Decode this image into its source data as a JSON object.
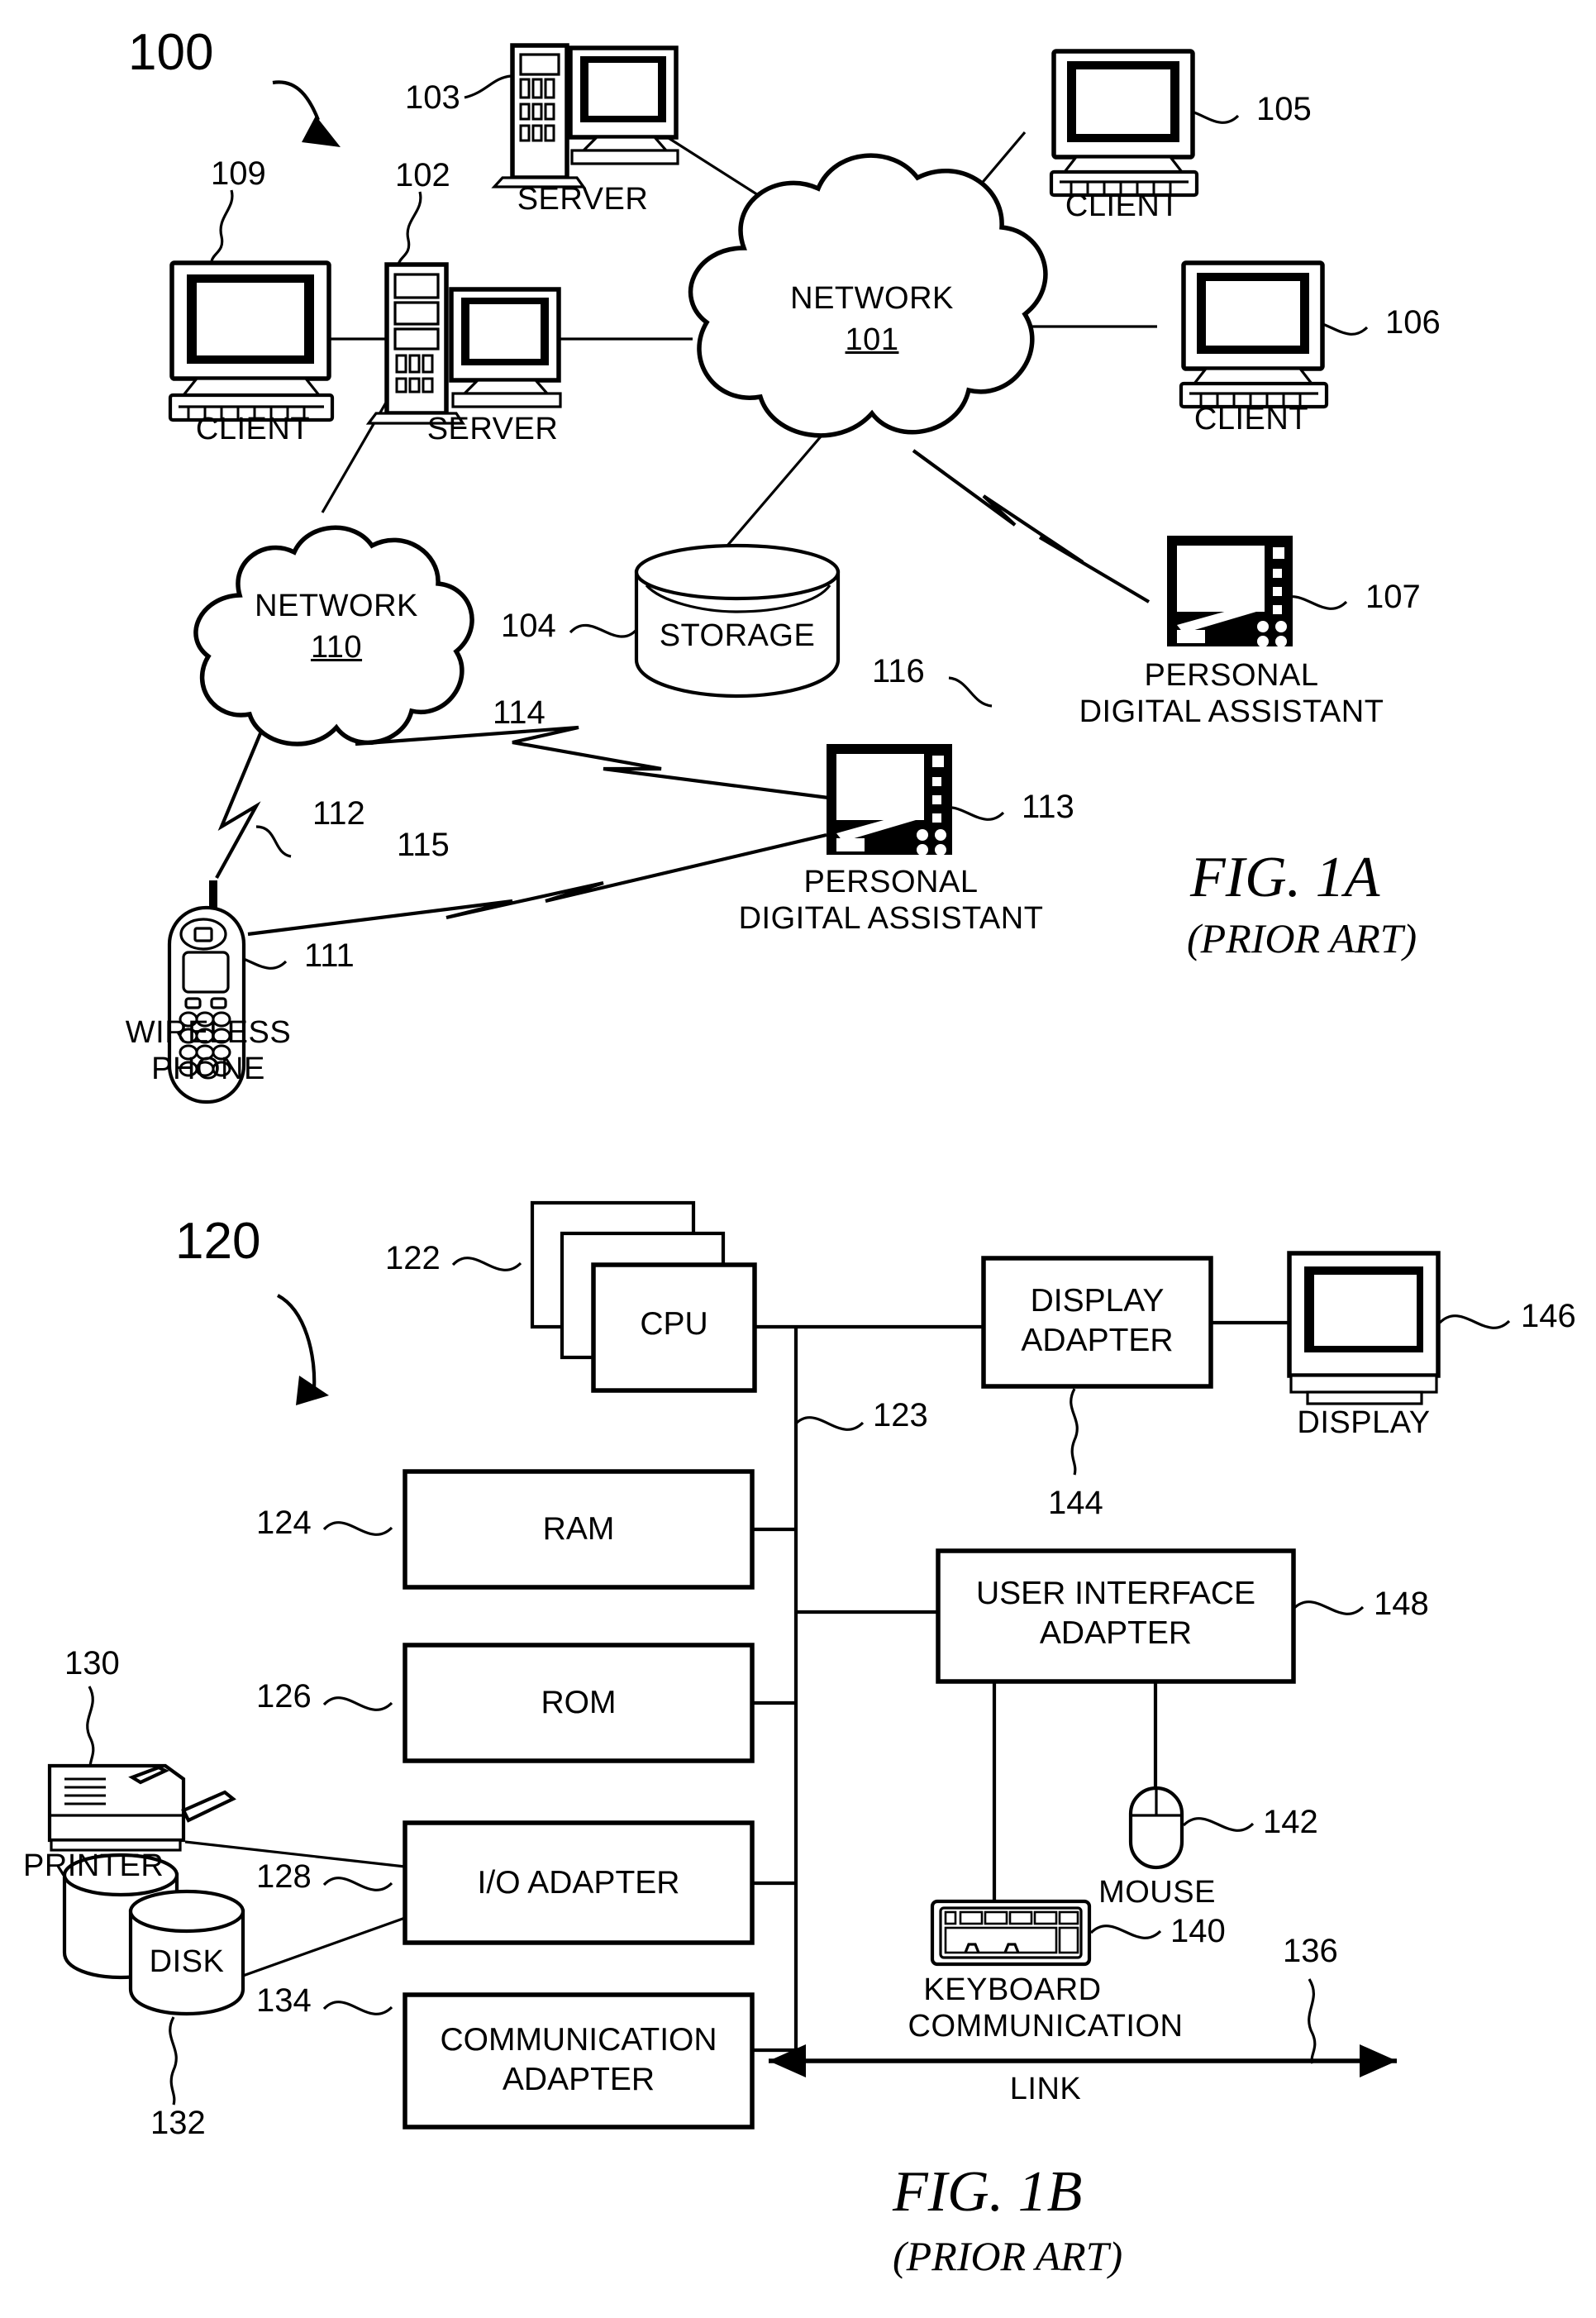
{
  "figures": [
    {
      "id": "fig-1a",
      "caption": "FIG. 1A",
      "subcaption": "(PRIOR ART)",
      "system_ref": "100",
      "nodes": [
        {
          "ref": "109",
          "label": "CLIENT",
          "type": "desktop-computer"
        },
        {
          "ref": "102",
          "label": "SERVER",
          "type": "server-tower"
        },
        {
          "ref": "103",
          "label": "SERVER",
          "type": "server-tower"
        },
        {
          "ref": "105",
          "label": "CLIENT",
          "type": "desktop-computer"
        },
        {
          "ref": "106",
          "label": "CLIENT",
          "type": "desktop-computer"
        },
        {
          "ref": "101",
          "label": "NETWORK",
          "type": "cloud"
        },
        {
          "ref": "110",
          "label": "NETWORK",
          "type": "cloud"
        },
        {
          "ref": "104",
          "label": "STORAGE",
          "type": "storage-cylinder"
        },
        {
          "ref": "107",
          "label": "PERSONAL DIGITAL ASSISTANT",
          "type": "pda"
        },
        {
          "ref": "113",
          "label": "PERSONAL DIGITAL ASSISTANT",
          "type": "pda"
        },
        {
          "ref": "111",
          "label": "WIRELESS PHONE",
          "type": "wireless-phone"
        }
      ],
      "wireless_links": [
        {
          "ref": "112"
        },
        {
          "ref": "114"
        },
        {
          "ref": "115"
        },
        {
          "ref": "116"
        }
      ]
    },
    {
      "id": "fig-1b",
      "caption": "FIG. 1B",
      "subcaption": "(PRIOR ART)",
      "system_ref": "120",
      "blocks": [
        {
          "ref": "122",
          "label": "CPU"
        },
        {
          "ref": "124",
          "label": "RAM"
        },
        {
          "ref": "126",
          "label": "ROM"
        },
        {
          "ref": "128",
          "label": "I/O ADAPTER"
        },
        {
          "ref": "134",
          "label": "COMMUNICATION ADAPTER"
        },
        {
          "ref": "144",
          "label": "DISPLAY ADAPTER"
        },
        {
          "ref": "148",
          "label": "USER INTERFACE ADAPTER"
        }
      ],
      "peripherals": [
        {
          "ref": "130",
          "label": "PRINTER"
        },
        {
          "ref": "132",
          "label": "DISK"
        },
        {
          "ref": "146",
          "label": "DISPLAY"
        },
        {
          "ref": "142",
          "label": "MOUSE"
        },
        {
          "ref": "140",
          "label": "KEYBOARD"
        }
      ],
      "bus": {
        "ref": "123"
      },
      "link": {
        "ref": "136",
        "label_line1": "COMMUNICATION",
        "label_line2": "LINK"
      }
    }
  ],
  "labels": {
    "client": "CLIENT",
    "server": "SERVER",
    "network": "NETWORK",
    "storage": "STORAGE",
    "pda_line1": "PERSONAL",
    "pda_line2": "DIGITAL ASSISTANT",
    "wireless_line1": "WIRELESS",
    "wireless_line2": "PHONE",
    "cpu": "CPU",
    "ram": "RAM",
    "rom": "ROM",
    "io_adapter": "I/O ADAPTER",
    "comm_adapter_l1": "COMMUNICATION",
    "comm_adapter_l2": "ADAPTER",
    "display_adapter_l1": "DISPLAY",
    "display_adapter_l2": "ADAPTER",
    "ui_adapter_l1": "USER INTERFACE",
    "ui_adapter_l2": "ADAPTER",
    "display": "DISPLAY",
    "mouse": "MOUSE",
    "keyboard": "KEYBOARD",
    "printer": "PRINTER",
    "disk": "DISK",
    "comm_link_l1": "COMMUNICATION",
    "comm_link_l2": "LINK"
  },
  "refs": {
    "r100": "100",
    "r101": "101",
    "r102": "102",
    "r103": "103",
    "r104": "104",
    "r105": "105",
    "r106": "106",
    "r107": "107",
    "r109": "109",
    "r110": "110",
    "r111": "111",
    "r112": "112",
    "r113": "113",
    "r114": "114",
    "r115": "115",
    "r116": "116",
    "r120": "120",
    "r122": "122",
    "r123": "123",
    "r124": "124",
    "r126": "126",
    "r128": "128",
    "r130": "130",
    "r132": "132",
    "r134": "134",
    "r136": "136",
    "r140": "140",
    "r142": "142",
    "r144": "144",
    "r146": "146",
    "r148": "148"
  },
  "captions": {
    "fig1a": "FIG. 1A",
    "fig1a_sub": "(PRIOR ART)",
    "fig1b": "FIG. 1B",
    "fig1b_sub": "(PRIOR ART)"
  },
  "colors": {
    "ink": "#000000",
    "paper": "#ffffff"
  }
}
